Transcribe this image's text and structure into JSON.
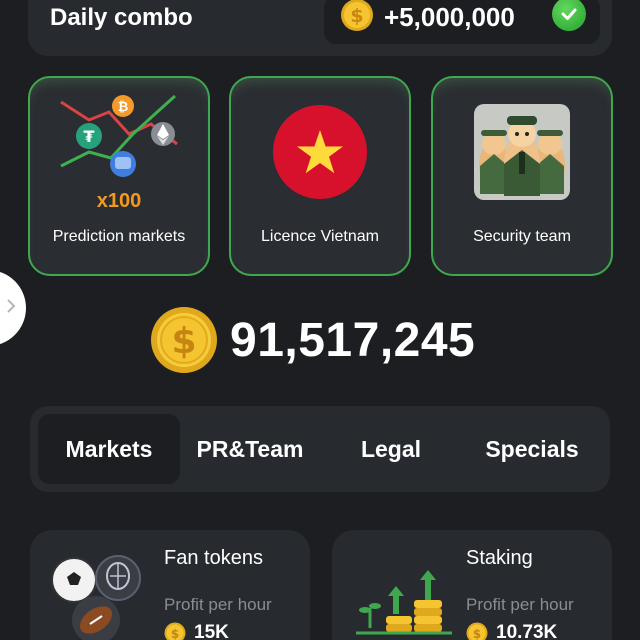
{
  "daily_combo": {
    "title": "Daily combo",
    "reward": "+5,000,000",
    "completed": true
  },
  "cards": [
    {
      "label": "Prediction markets",
      "badge": "x100",
      "icon": "crypto-chart-icon"
    },
    {
      "label": "Licence Vietnam",
      "icon": "vietnam-flag-icon"
    },
    {
      "label": "Security team",
      "icon": "hamster-guards-image"
    }
  ],
  "balance": {
    "value": "91,517,245",
    "icon": "coin-icon"
  },
  "tabs": [
    {
      "label": "Markets",
      "active": true
    },
    {
      "label": "PR&Team",
      "active": false
    },
    {
      "label": "Legal",
      "active": false
    },
    {
      "label": "Specials",
      "active": false
    }
  ],
  "market_cards": [
    {
      "title": "Fan tokens",
      "profit_label": "Profit per hour",
      "profit_value": "15K",
      "icon": "sports-balls-icon"
    },
    {
      "title": "Staking",
      "profit_label": "Profit per hour",
      "profit_value": "10.73K",
      "icon": "coin-stacks-growth-icon"
    }
  ],
  "colors": {
    "background": "#1c1e21",
    "card": "#2a2d32",
    "accent_green": "#3fa84f",
    "coin_gold": "#f5c531",
    "muted_text": "#8a8d93"
  }
}
